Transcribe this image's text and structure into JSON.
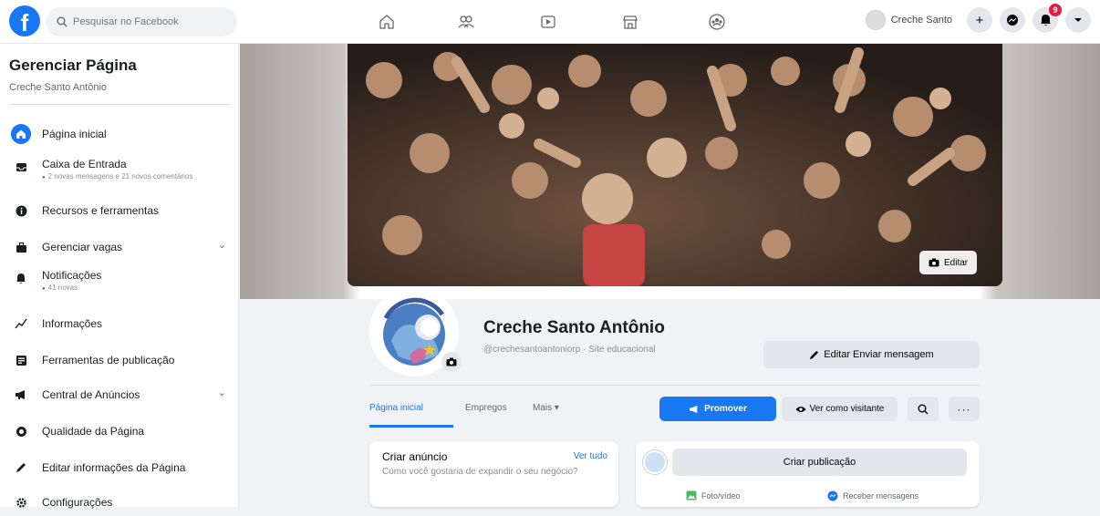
{
  "topbar": {
    "logo": "f",
    "search_placeholder": "Pesquisar no Facebook",
    "nav_icons": [
      "home-icon",
      "pages-icon",
      "watch-icon",
      "marketplace-icon",
      "groups-icon"
    ],
    "profile_name": "Creche Santo",
    "notifications_count": "9",
    "icons": [
      "plus-icon",
      "messenger-icon",
      "bell-icon",
      "caret-down-icon"
    ]
  },
  "sidebar": {
    "title": "Gerenciar Página",
    "page_name": "Creche Santo Antônio",
    "items": [
      {
        "label": "Página inicial",
        "icon": "home-icon",
        "active": true
      },
      {
        "label": "Caixa de Entrada",
        "meta": "2 novas mensagens e 21 novos comentários",
        "icon": "inbox-icon"
      },
      {
        "label": "Recursos e ferramentas",
        "icon": "info-icon"
      },
      {
        "label": "Gerenciar vagas",
        "icon": "briefcase-icon",
        "expandable": true
      },
      {
        "label": "Notificações",
        "meta": "41 novas",
        "icon": "bell-icon"
      },
      {
        "label": "Informações",
        "icon": "insights-icon"
      },
      {
        "label": "Ferramentas de publicação",
        "icon": "publishing-icon"
      },
      {
        "label": "Central de Anúncios",
        "icon": "megaphone-icon",
        "expandable": true
      },
      {
        "label": "Qualidade da Página",
        "icon": "quality-icon"
      },
      {
        "label": "Editar informações da Página",
        "icon": "pencil-icon"
      },
      {
        "label": "Configurações",
        "icon": "gear-icon"
      }
    ]
  },
  "cover": {
    "edit_label": "Editar",
    "colors": {
      "accent": "#1877f2"
    }
  },
  "profile": {
    "name": "Creche Santo Antônio",
    "handle": "@crechesantoantoniorp · Site educacional",
    "edit_send_label": "Editar Enviar mensagem"
  },
  "tabs": {
    "items": [
      "Página inicial",
      "Empregos",
      "Mais ▾"
    ],
    "promote_label": "Promover",
    "view_as_visitor_label": "Ver como visitante"
  },
  "create_ad": {
    "title": "Criar anúncio",
    "see_all": "Ver tudo",
    "subtitle": "Como você gostaria de expandir o seu negócio?"
  },
  "create_post": {
    "button_label": "Criar publicação",
    "photo_video": "Foto/vídeo",
    "receive_messages": "Receber mensagens"
  }
}
